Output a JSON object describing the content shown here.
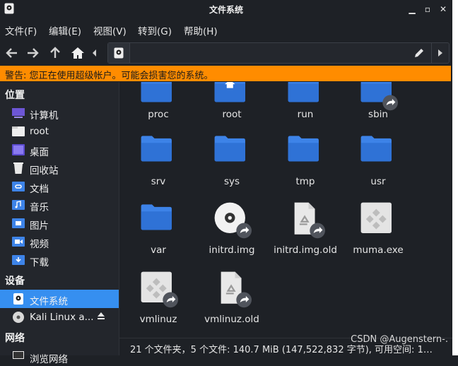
{
  "window": {
    "title": "文件系统"
  },
  "menu": [
    "文件(F)",
    "编辑(E)",
    "视图(V)",
    "转到(G)",
    "帮助(H)"
  ],
  "location": {
    "value": ""
  },
  "warning": "警告: 您正在使用超级帐户。可能会损害您的系统。",
  "sidebar": {
    "places_header": "位置",
    "places": [
      {
        "label": "计算机",
        "icon": "computer-icon"
      },
      {
        "label": "root",
        "icon": "home-folder-icon"
      },
      {
        "label": "桌面",
        "icon": "desktop-icon"
      },
      {
        "label": "回收站",
        "icon": "trash-icon"
      },
      {
        "label": "文档",
        "icon": "documents-icon"
      },
      {
        "label": "音乐",
        "icon": "music-icon"
      },
      {
        "label": "图片",
        "icon": "pictures-icon"
      },
      {
        "label": "视频",
        "icon": "videos-icon"
      },
      {
        "label": "下载",
        "icon": "downloads-icon"
      }
    ],
    "devices_header": "设备",
    "devices": [
      {
        "label": "文件系统",
        "icon": "drive-icon",
        "selected": true
      },
      {
        "label": "Kali Linux a...",
        "icon": "optical-disc-icon",
        "selected": false
      }
    ],
    "network_header": "网络",
    "network": [
      {
        "label": "浏览网络",
        "icon": "network-icon"
      }
    ]
  },
  "files": [
    {
      "name": "proc",
      "type": "folder"
    },
    {
      "name": "root",
      "type": "home-folder"
    },
    {
      "name": "run",
      "type": "folder"
    },
    {
      "name": "sbin",
      "type": "folder-link"
    },
    {
      "name": "srv",
      "type": "folder"
    },
    {
      "name": "sys",
      "type": "folder"
    },
    {
      "name": "tmp",
      "type": "folder"
    },
    {
      "name": "usr",
      "type": "folder"
    },
    {
      "name": "var",
      "type": "folder"
    },
    {
      "name": "initrd.img",
      "type": "disc-link"
    },
    {
      "name": "initrd.img.old",
      "type": "recycle-link"
    },
    {
      "name": "muma.exe",
      "type": "exe"
    },
    {
      "name": "vmlinuz",
      "type": "exe-link"
    },
    {
      "name": "vmlinuz.old",
      "type": "recycle-link"
    }
  ],
  "status": "21 个文件夹，5 个文件: 140.7 MiB (147,522,832 字节), 可用空间: 1…",
  "watermark": "CSDN @Augenstern-.",
  "colors": {
    "accent": "#368ff0",
    "warning": "#ff8c00",
    "folder": "#3d83e8",
    "background": "#1e2126"
  }
}
